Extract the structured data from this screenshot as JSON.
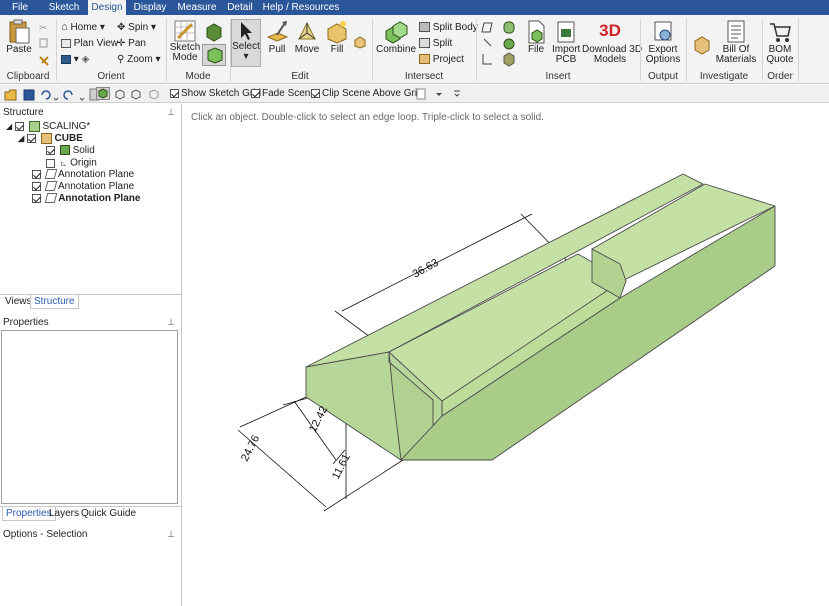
{
  "menu": {
    "tabs": [
      "File",
      "Sketch",
      "Design",
      "Display",
      "Measure",
      "Detail",
      "Help / Resources"
    ],
    "active": "Design"
  },
  "ribbon": {
    "clipboard": {
      "label": "Clipboard",
      "paste": "Paste"
    },
    "orient": {
      "label": "Orient",
      "home": "Home",
      "plan_view": "Plan View",
      "spin": "Spin",
      "pan": "Pan",
      "zoom": "Zoom"
    },
    "mode": {
      "label": "Mode",
      "sketch_mode_1": "Sketch",
      "sketch_mode_2": "Mode"
    },
    "edit": {
      "label": "Edit",
      "select": "Select",
      "pull": "Pull",
      "move": "Move",
      "fill": "Fill"
    },
    "intersect": {
      "label": "Intersect",
      "combine": "Combine",
      "split_body": "Split Body",
      "split": "Split",
      "project": "Project"
    },
    "insert": {
      "label": "Insert",
      "file": "File",
      "import_pcb_1": "Import",
      "import_pcb_2": "PCB",
      "download_3d_1": "Download 3D",
      "download_3d_2": "Models",
      "download_badge": "3D"
    },
    "output": {
      "label": "Output",
      "export_1": "Export",
      "export_2": "Options"
    },
    "investigate": {
      "label": "Investigate",
      "bom_1": "Bill Of",
      "bom_2": "Materials"
    },
    "order": {
      "label": "Order",
      "bom_quote_1": "BOM",
      "bom_quote_2": "Quote"
    }
  },
  "toolbar": {
    "show_sketch_grid": "Show Sketch Grid",
    "fade_scene": "Fade Scene",
    "clip_scene": "Clip Scene Above Grid"
  },
  "structure": {
    "title": "Structure",
    "items": [
      "SCALING*",
      "CUBE",
      "Solid",
      "Origin",
      "Annotation Plane",
      "Annotation Plane",
      "Annotation Plane"
    ]
  },
  "left_tabs_top": [
    "Views",
    "Structure"
  ],
  "properties": {
    "title": "Properties"
  },
  "left_tabs_bottom": [
    "Properties",
    "Layers",
    "Quick Guide"
  ],
  "options": {
    "title": "Options - Selection"
  },
  "viewport": {
    "hint": "Click an object. Double-click to select an edge loop. Triple-click to select a solid.",
    "dimensions": [
      "36.63",
      "24.76",
      "12.42",
      "11.61"
    ],
    "solid_color": "#c5e0a5"
  },
  "colors": {
    "accent": "#2b579a",
    "solid_top": "#c5e0a5",
    "solid_side": "#a9cc88",
    "solid_front": "#b7d69a"
  }
}
